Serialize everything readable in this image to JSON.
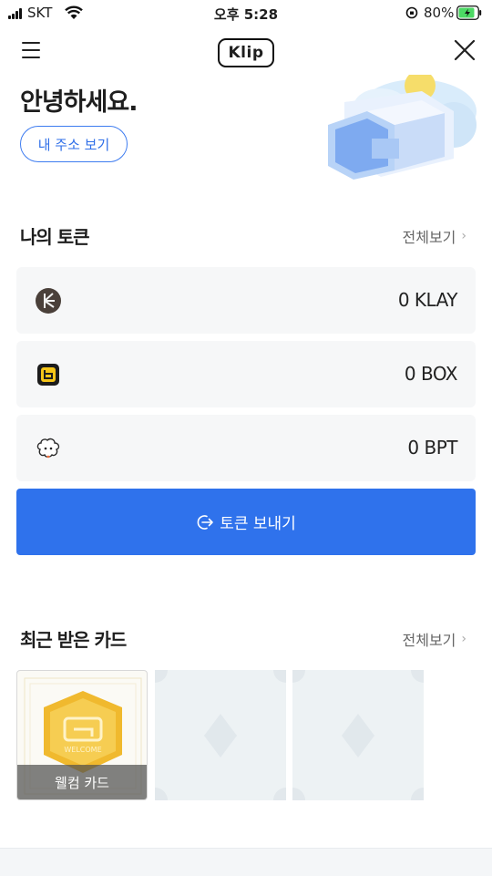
{
  "status_bar": {
    "carrier": "SKT",
    "time": "오후 5:28",
    "battery": "80%"
  },
  "nav": {
    "logo": "Klip"
  },
  "greeting": {
    "title": "안녕하세요.",
    "address_button": "내 주소 보기"
  },
  "tokens": {
    "title": "나의 토큰",
    "view_all": "전체보기",
    "items": [
      {
        "icon": "klay-icon",
        "amount": "0 KLAY"
      },
      {
        "icon": "box-icon",
        "amount": "0 BOX"
      },
      {
        "icon": "bpt-icon",
        "amount": "0 BPT"
      }
    ],
    "send_button": "토큰 보내기"
  },
  "cards": {
    "title": "최근 받은 카드",
    "view_all": "전체보기",
    "welcome_badge_text": "WELCOME",
    "welcome_caption": "웰컴 카드"
  },
  "colors": {
    "accent": "#2f72ec",
    "outline_blue": "#3e7cf0",
    "card_bg": "#f6f7f8",
    "battery_green": "#4cd964"
  }
}
